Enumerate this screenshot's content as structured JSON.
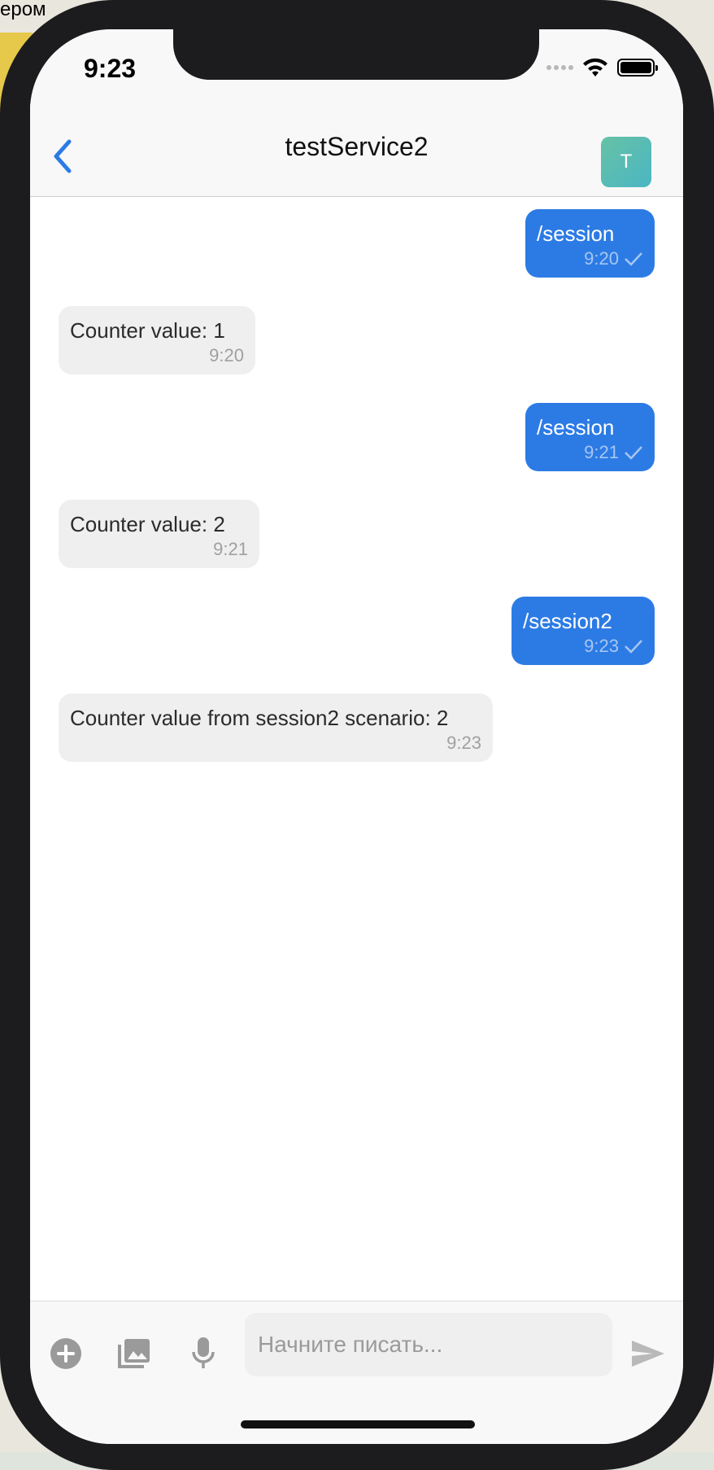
{
  "background": {
    "corner_text": "ером"
  },
  "status_bar": {
    "time": "9:23"
  },
  "header": {
    "title": "testService2",
    "avatar_letter": "T",
    "back_icon": "chevron-left-icon"
  },
  "messages": [
    {
      "direction": "out",
      "text": "/session",
      "time": "9:20"
    },
    {
      "direction": "in",
      "text": "Counter value: 1",
      "time": "9:20"
    },
    {
      "direction": "out",
      "text": "/session",
      "time": "9:21"
    },
    {
      "direction": "in",
      "text": "Counter value: 2",
      "time": "9:21"
    },
    {
      "direction": "out",
      "text": "/session2",
      "time": "9:23"
    },
    {
      "direction": "in",
      "text": "Counter value from session2 scenario: 2",
      "time": "9:23"
    }
  ],
  "composer": {
    "placeholder": "Начните писать...",
    "value": "",
    "icons": [
      "plus-circle-icon",
      "image-gallery-icon",
      "microphone-icon",
      "send-icon"
    ]
  },
  "colors": {
    "accent": "#2c7be5",
    "incoming_bubble": "#efefef",
    "avatar": "#5bbdb0"
  }
}
